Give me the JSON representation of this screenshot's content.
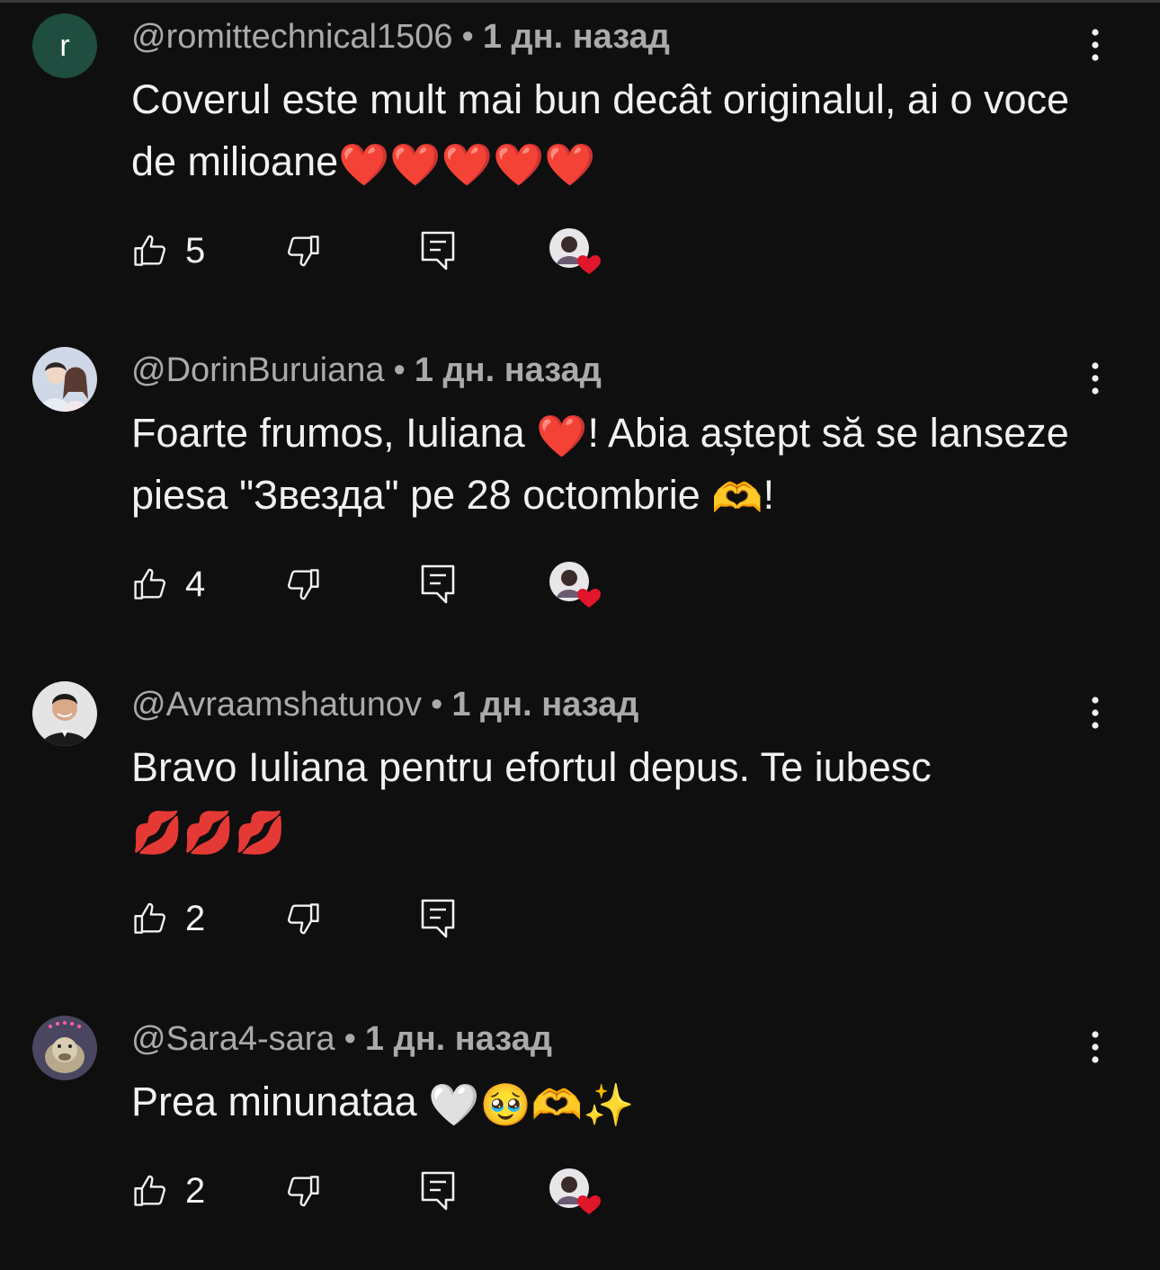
{
  "comments": [
    {
      "author": "@romittechnical1506",
      "time": "1 дн. назад",
      "text": "Coverul este mult mai bun decât originalul, ai o voce de milioane",
      "emojis": "❤️❤️❤️❤️❤️",
      "likes": "5",
      "avatar_letter": "r",
      "hearted": true
    },
    {
      "author": "@DorinBuruiana",
      "time": "1 дн. назад",
      "text_part1": "Foarte frumos, Iuliana ",
      "emoji1": "❤️",
      "text_part2": "! Abia aștept să se lanseze piesa \"Звезда\" pe 28 octombrie ",
      "emoji2": "🫶",
      "text_part3": "!",
      "likes": "4",
      "hearted": true
    },
    {
      "author": "@Avraamshatunov",
      "time": "1 дн. назад",
      "text": "Bravo Iuliana pentru efortul depus. Te iubesc",
      "emojis": "💋💋💋",
      "likes": "2",
      "hearted": false
    },
    {
      "author": "@Sara4-sara",
      "time": "1 дн. назад",
      "text": "Prea minunataa ",
      "emojis": "🤍🥹🫶✨",
      "likes": "2",
      "hearted": true
    }
  ],
  "separator": "•",
  "icons": {
    "like": "thumbs-up-icon",
    "dislike": "thumbs-down-icon",
    "reply": "reply-icon",
    "more": "more-vertical-icon",
    "creator_heart": "creator-heart-icon"
  },
  "colors": {
    "background": "#0f0f0f",
    "text": "#f1f1f1",
    "secondary_text": "#aaaaaa",
    "heart": "#e2162b"
  }
}
